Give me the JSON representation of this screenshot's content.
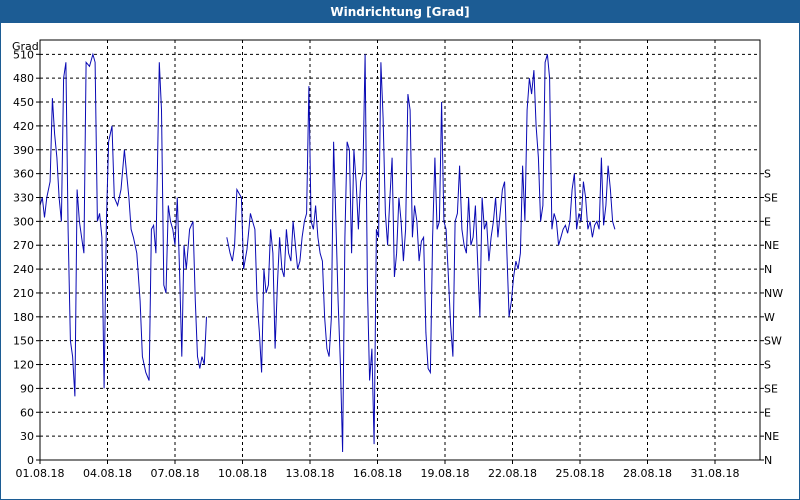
{
  "chart_data": {
    "type": "line",
    "title": "Windrichtung [Grad]",
    "ylabel": "Grad",
    "ylim": [
      0,
      528
    ],
    "y_ticks": [
      0,
      30,
      60,
      90,
      120,
      150,
      180,
      210,
      240,
      270,
      300,
      330,
      360,
      390,
      420,
      450,
      480,
      510
    ],
    "x_tick_labels": [
      "01.08.18",
      "04.08.18",
      "07.08.18",
      "10.08.18",
      "13.08.18",
      "16.08.18",
      "19.08.18",
      "22.08.18",
      "25.08.18",
      "28.08.18",
      "31.08.18"
    ],
    "x_range_days": [
      0,
      32
    ],
    "right_axis": {
      "label_values": [
        0,
        30,
        60,
        90,
        120,
        150,
        180,
        210,
        240,
        270,
        300,
        330,
        360,
        390,
        420,
        450,
        480,
        510
      ],
      "labels": [
        "N",
        "NE",
        "E",
        "SE",
        "S",
        "SW",
        "W",
        "NW",
        "N",
        "NE",
        "E",
        "SE",
        "S"
      ],
      "label_y_values": [
        0,
        30,
        60,
        90,
        120,
        150,
        180,
        210,
        240,
        270,
        300,
        330,
        360,
        390,
        420,
        450,
        480,
        510
      ]
    },
    "grid": true,
    "colors": {
      "line": "#0a0ab4",
      "grid": "#000000",
      "title_bar": "#1c5c94"
    },
    "series": [
      {
        "points": [
          [
            0.0,
            320
          ],
          [
            0.1,
            330
          ],
          [
            0.2,
            305
          ],
          [
            0.3,
            330
          ],
          [
            0.45,
            350
          ],
          [
            0.55,
            455
          ],
          [
            0.65,
            410
          ],
          [
            0.75,
            380
          ],
          [
            0.85,
            330
          ],
          [
            0.95,
            300
          ],
          [
            1.05,
            480
          ],
          [
            1.15,
            500
          ],
          [
            1.25,
            290
          ],
          [
            1.35,
            150
          ],
          [
            1.45,
            130
          ],
          [
            1.55,
            80
          ],
          [
            1.65,
            340
          ],
          [
            1.75,
            300
          ],
          [
            1.85,
            280
          ],
          [
            1.95,
            260
          ],
          [
            2.05,
            500
          ],
          [
            2.2,
            495
          ],
          [
            2.35,
            510
          ],
          [
            2.45,
            500
          ],
          [
            2.55,
            300
          ],
          [
            2.65,
            310
          ],
          [
            2.75,
            280
          ],
          [
            2.85,
            90
          ],
          [
            2.95,
            300
          ],
          [
            3.05,
            400
          ],
          [
            3.2,
            420
          ],
          [
            3.3,
            330
          ],
          [
            3.45,
            320
          ],
          [
            3.6,
            340
          ],
          [
            3.75,
            390
          ],
          [
            3.85,
            360
          ],
          [
            3.95,
            330
          ],
          [
            4.05,
            290
          ],
          [
            4.15,
            280
          ],
          [
            4.3,
            260
          ],
          [
            4.45,
            200
          ],
          [
            4.55,
            130
          ],
          [
            4.7,
            110
          ],
          [
            4.85,
            100
          ],
          [
            4.95,
            290
          ],
          [
            5.05,
            295
          ],
          [
            5.15,
            260
          ],
          [
            5.3,
            500
          ],
          [
            5.4,
            440
          ],
          [
            5.5,
            220
          ],
          [
            5.6,
            210
          ],
          [
            5.7,
            320
          ],
          [
            5.8,
            300
          ],
          [
            5.9,
            290
          ],
          [
            6.0,
            270
          ],
          [
            6.1,
            330
          ],
          [
            6.2,
            240
          ],
          [
            6.3,
            130
          ],
          [
            6.4,
            270
          ],
          [
            6.5,
            240
          ],
          [
            6.65,
            290
          ],
          [
            6.8,
            300
          ],
          [
            6.9,
            200
          ],
          [
            7.0,
            130
          ],
          [
            7.1,
            115
          ],
          [
            7.2,
            130
          ],
          [
            7.3,
            120
          ],
          [
            7.4,
            180
          ],
          [
            8.3,
            280
          ],
          [
            8.45,
            260
          ],
          [
            8.55,
            250
          ],
          [
            8.65,
            270
          ],
          [
            8.75,
            340
          ],
          [
            8.85,
            335
          ],
          [
            8.95,
            330
          ],
          [
            9.05,
            240
          ],
          [
            9.2,
            265
          ],
          [
            9.35,
            310
          ],
          [
            9.45,
            300
          ],
          [
            9.55,
            290
          ],
          [
            9.65,
            200
          ],
          [
            9.75,
            160
          ],
          [
            9.85,
            110
          ],
          [
            9.95,
            240
          ],
          [
            10.05,
            210
          ],
          [
            10.15,
            220
          ],
          [
            10.25,
            290
          ],
          [
            10.35,
            260
          ],
          [
            10.45,
            140
          ],
          [
            10.55,
            220
          ],
          [
            10.65,
            280
          ],
          [
            10.75,
            240
          ],
          [
            10.85,
            230
          ],
          [
            10.95,
            290
          ],
          [
            11.05,
            260
          ],
          [
            11.15,
            250
          ],
          [
            11.25,
            300
          ],
          [
            11.35,
            270
          ],
          [
            11.45,
            240
          ],
          [
            11.55,
            250
          ],
          [
            11.65,
            280
          ],
          [
            11.75,
            300
          ],
          [
            11.85,
            310
          ],
          [
            11.95,
            470
          ],
          [
            12.05,
            300
          ],
          [
            12.15,
            290
          ],
          [
            12.25,
            320
          ],
          [
            12.35,
            280
          ],
          [
            12.45,
            260
          ],
          [
            12.55,
            250
          ],
          [
            12.65,
            180
          ],
          [
            12.75,
            140
          ],
          [
            12.85,
            130
          ],
          [
            12.95,
            180
          ],
          [
            13.05,
            400
          ],
          [
            13.15,
            300
          ],
          [
            13.25,
            200
          ],
          [
            13.35,
            120
          ],
          [
            13.45,
            10
          ],
          [
            13.55,
            280
          ],
          [
            13.65,
            400
          ],
          [
            13.75,
            390
          ],
          [
            13.85,
            260
          ],
          [
            13.95,
            390
          ],
          [
            14.05,
            350
          ],
          [
            14.15,
            290
          ],
          [
            14.25,
            350
          ],
          [
            14.35,
            360
          ],
          [
            14.45,
            510
          ],
          [
            14.55,
            220
          ],
          [
            14.65,
            100
          ],
          [
            14.75,
            140
          ],
          [
            14.85,
            20
          ],
          [
            14.95,
            290
          ],
          [
            15.05,
            280
          ],
          [
            15.15,
            500
          ],
          [
            15.25,
            430
          ],
          [
            15.35,
            310
          ],
          [
            15.45,
            270
          ],
          [
            15.55,
            330
          ],
          [
            15.65,
            380
          ],
          [
            15.75,
            230
          ],
          [
            15.85,
            260
          ],
          [
            15.95,
            330
          ],
          [
            16.05,
            300
          ],
          [
            16.15,
            250
          ],
          [
            16.25,
            290
          ],
          [
            16.35,
            460
          ],
          [
            16.45,
            440
          ],
          [
            16.55,
            280
          ],
          [
            16.65,
            320
          ],
          [
            16.75,
            300
          ],
          [
            16.85,
            250
          ],
          [
            16.95,
            275
          ],
          [
            17.05,
            280
          ],
          [
            17.15,
            160
          ],
          [
            17.25,
            115
          ],
          [
            17.35,
            110
          ],
          [
            17.45,
            280
          ],
          [
            17.55,
            380
          ],
          [
            17.65,
            290
          ],
          [
            17.75,
            300
          ],
          [
            17.85,
            450
          ],
          [
            17.95,
            300
          ],
          [
            18.05,
            290
          ],
          [
            18.15,
            230
          ],
          [
            18.25,
            170
          ],
          [
            18.35,
            130
          ],
          [
            18.45,
            300
          ],
          [
            18.55,
            310
          ],
          [
            18.65,
            370
          ],
          [
            18.75,
            290
          ],
          [
            18.85,
            270
          ],
          [
            18.95,
            260
          ],
          [
            19.05,
            330
          ],
          [
            19.15,
            270
          ],
          [
            19.25,
            280
          ],
          [
            19.35,
            320
          ],
          [
            19.45,
            250
          ],
          [
            19.55,
            180
          ],
          [
            19.65,
            330
          ],
          [
            19.75,
            290
          ],
          [
            19.85,
            300
          ],
          [
            19.95,
            250
          ],
          [
            20.05,
            280
          ],
          [
            20.15,
            300
          ],
          [
            20.25,
            330
          ],
          [
            20.35,
            280
          ],
          [
            20.45,
            310
          ],
          [
            20.55,
            340
          ],
          [
            20.65,
            350
          ],
          [
            20.75,
            260
          ],
          [
            20.85,
            180
          ],
          [
            20.95,
            200
          ],
          [
            21.05,
            230
          ],
          [
            21.15,
            250
          ],
          [
            21.25,
            240
          ],
          [
            21.35,
            260
          ],
          [
            21.45,
            370
          ],
          [
            21.55,
            300
          ],
          [
            21.65,
            440
          ],
          [
            21.75,
            480
          ],
          [
            21.85,
            460
          ],
          [
            21.95,
            490
          ],
          [
            22.05,
            420
          ],
          [
            22.15,
            380
          ],
          [
            22.25,
            300
          ],
          [
            22.35,
            320
          ],
          [
            22.45,
            500
          ],
          [
            22.55,
            510
          ],
          [
            22.65,
            480
          ],
          [
            22.75,
            290
          ],
          [
            22.85,
            310
          ],
          [
            22.95,
            300
          ],
          [
            23.05,
            270
          ],
          [
            23.15,
            280
          ],
          [
            23.25,
            290
          ],
          [
            23.35,
            295
          ],
          [
            23.45,
            285
          ],
          [
            23.55,
            300
          ],
          [
            23.65,
            340
          ],
          [
            23.75,
            360
          ],
          [
            23.85,
            290
          ],
          [
            23.95,
            310
          ],
          [
            24.05,
            300
          ],
          [
            24.15,
            350
          ],
          [
            24.25,
            330
          ],
          [
            24.35,
            290
          ],
          [
            24.45,
            300
          ],
          [
            24.55,
            280
          ],
          [
            24.65,
            295
          ],
          [
            24.75,
            300
          ],
          [
            24.85,
            290
          ],
          [
            24.95,
            380
          ],
          [
            25.05,
            295
          ],
          [
            25.15,
            320
          ],
          [
            25.25,
            370
          ],
          [
            25.35,
            340
          ],
          [
            25.45,
            300
          ],
          [
            25.55,
            290
          ]
        ]
      }
    ]
  }
}
